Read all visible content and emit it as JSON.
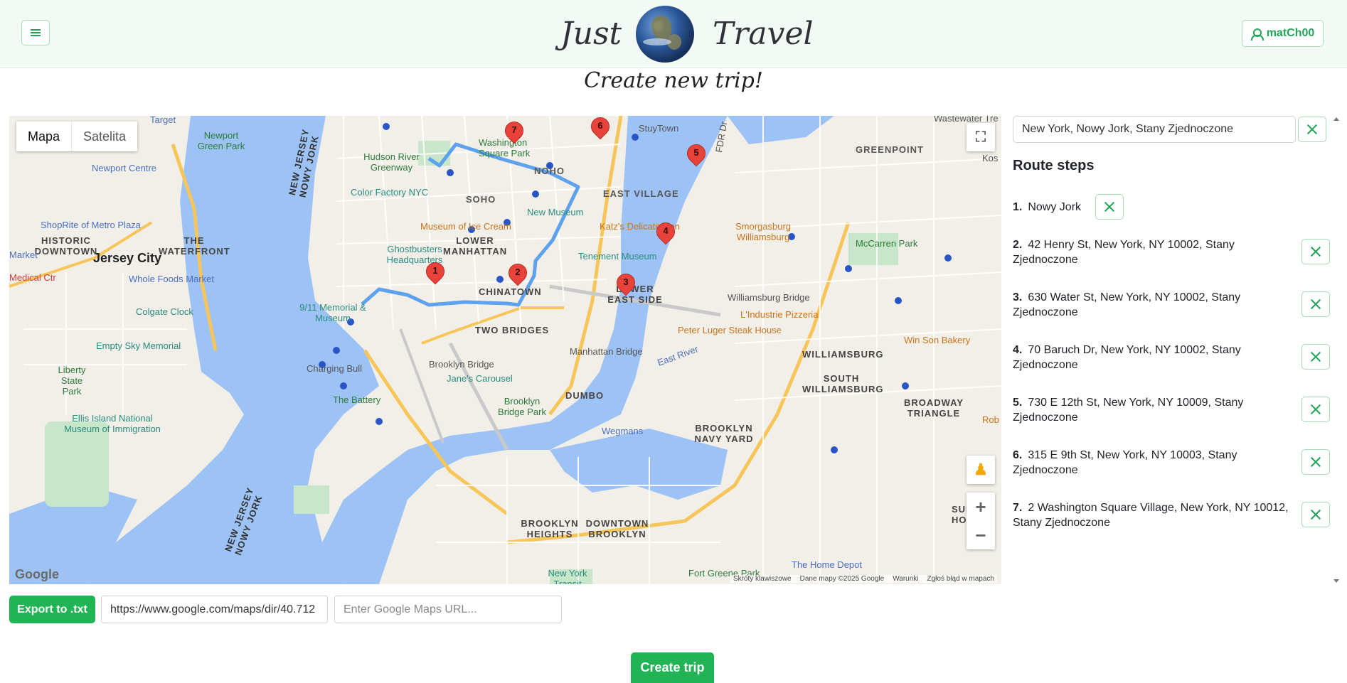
{
  "header": {
    "brand_left": "Just",
    "brand_right": "Travel",
    "user_name": "matCh00",
    "menu_icon": "hamburger-icon",
    "user_icon": "person-icon"
  },
  "page_title": "Create new trip!",
  "map": {
    "type_options": [
      "Mapa",
      "Satelita"
    ],
    "selected_type": "Mapa",
    "footer": [
      "Skróty klawiszowe",
      "Dane mapy ©2025 Google",
      "Warunki",
      "Zgłoś błąd w mapach"
    ],
    "logo": "Google",
    "labels": {
      "target": "Target",
      "newport_green": "Newport Green Park",
      "newport_centre": "Newport Centre",
      "hudson_river": "Hudson River Greenway",
      "color_factory": "Color Factory NYC",
      "washington_sq": "Washington Square Park",
      "noho": "NOHO",
      "stuytown": "StuyTown",
      "greenpoint": "GREENPOINT",
      "east_village": "EAST VILLAGE",
      "soho": "SOHO",
      "new_museum": "New Museum",
      "museum_ice_cream": "Museum of Ice Cream",
      "katz": "Katz's Delicatessen",
      "shoprite": "ShopRite of Metro Plaza",
      "historic_downtown": "HISTORIC DOWNTOWN",
      "the_waterfront": "THE WATERFRONT",
      "lower_manhattan": "LOWER MANHATTAN",
      "ghostbusters": "Ghostbusters Headquarters",
      "jersey_city": "Jersey City",
      "whole_foods": "Whole Foods Market",
      "tenement": "Tenement Museum",
      "smorgasburg": "Smorgasburg Williamsburg",
      "mccarren": "McCarren Park",
      "market": "Market",
      "medical_ctr": "Medical Ctr",
      "chinatown": "CHINATOWN",
      "lower_east_side": "LOWER EAST SIDE",
      "williamsburg_bridge": "Williamsburg Bridge",
      "memorial_911": "9/11 Memorial & Museum",
      "colgate": "Colgate Clock",
      "two_bridges": "TWO BRIDGES",
      "lindustrie": "L'Industrie Pizzeria",
      "peter_luger": "Peter Luger Steak House",
      "win_son": "Win Son Bakery",
      "empty_sky": "Empty Sky Memorial",
      "manhattan_bridge": "Manhattan Bridge",
      "williamsburg": "WILLIAMSBURG",
      "charging_bull": "Charging Bull",
      "brooklyn_bridge": "Brooklyn Bridge",
      "liberty_state": "Liberty State Park",
      "janes_carousel": "Jane's Carousel",
      "south_williamsburg": "SOUTH WILLIAMSBURG",
      "broadway_triangle": "BROADWAY TRIANGLE",
      "the_battery": "The Battery",
      "dumbo": "DUMBO",
      "brooklyn_bridge_park": "Brooklyn Bridge Park",
      "ellis_island": "Ellis Island National Museum of Immigration",
      "wegmans": "Wegmans",
      "brooklyn_navy_yard": "BROOKLYN NAVY YARD",
      "new_jersey_top": "NEW JERSEY NOWY JORK",
      "new_jersey_bottom": "NEW JERSEY NOWY JORK",
      "brooklyn_heights": "BROOKLYN HEIGHTS",
      "downtown_brooklyn": "DOWNTOWN BROOKLYN",
      "home_depot": "The Home Depot",
      "fort_greene": "Fort Greene Park",
      "ny_transit": "New York Transit Museum",
      "kos": "Kos",
      "rob": "Rob",
      "wastewater": "Wastewater Tre",
      "summer": "SUMNER HO",
      "fdr": "FDR Dr",
      "east_river": "East River"
    }
  },
  "search": {
    "value": "New York, Nowy Jork, Stany Zjednoczone"
  },
  "route": {
    "title": "Route steps",
    "steps": [
      {
        "num": "1.",
        "text": "Nowy Jork"
      },
      {
        "num": "2.",
        "text": "42 Henry St, New York, NY 10002, Stany Zjednoczone"
      },
      {
        "num": "3.",
        "text": "630 Water St, New York, NY 10002, Stany Zjednoczone"
      },
      {
        "num": "4.",
        "text": "70 Baruch Dr, New York, NY 10002, Stany Zjednoczone"
      },
      {
        "num": "5.",
        "text": "730 E 12th St, New York, NY 10009, Stany Zjednoczone"
      },
      {
        "num": "6.",
        "text": "315 E 9th St, New York, NY 10003, Stany Zjednoczone"
      },
      {
        "num": "7.",
        "text": "2 Washington Square Village, New York, NY 10012, Stany Zjednoczone"
      }
    ],
    "pins": [
      "1",
      "2",
      "3",
      "4",
      "5",
      "6",
      "7"
    ]
  },
  "bottom": {
    "export_label": "Export to .txt",
    "url_value": "https://www.google.com/maps/dir/40.712",
    "url_placeholder": "Enter Google Maps URL...",
    "create_label": "Create trip"
  },
  "colors": {
    "accent": "#21b455",
    "route_line": "#5ea1ec",
    "pin": "#e8433a",
    "water": "#9dc2f5"
  }
}
